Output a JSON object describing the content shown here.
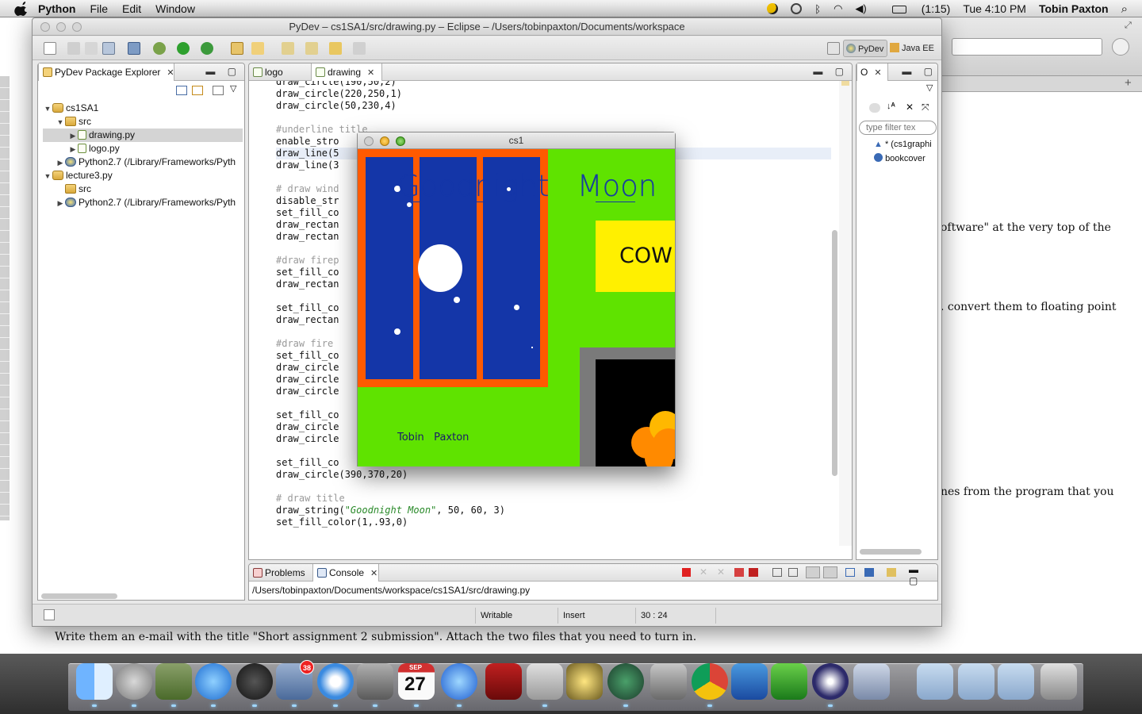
{
  "menubar": {
    "app_name": "Python",
    "menus": [
      "File",
      "Edit",
      "Window"
    ],
    "battery": "(1:15)",
    "clock": "Tue 4:10 PM",
    "user": "Tobin Paxton"
  },
  "browser_bg": {
    "lines": [
      "oftware\" at the very top of the",
      ". convert them to floating point",
      "nes from the program that you",
      "Write them an e-mail with the title \"Short assignment 2 submission\". Attach the two files that you need to turn in."
    ]
  },
  "eclipse": {
    "title": "PyDev – cs1SA1/src/drawing.py – Eclipse – /Users/tobinpaxton/Documents/workspace",
    "perspectives": [
      "PyDev",
      "Java EE"
    ],
    "package_explorer": {
      "tab_label": "PyDev Package Explorer",
      "tree": [
        {
          "label": "cs1SA1",
          "icon": "project-icon",
          "twisty": "▼",
          "depth": 0
        },
        {
          "label": "src",
          "icon": "folder-icon",
          "twisty": "▼",
          "depth": 1
        },
        {
          "label": "drawing.py",
          "icon": "python-file-icon",
          "twisty": "▶",
          "depth": 2,
          "selected": true
        },
        {
          "label": "logo.py",
          "icon": "python-file-icon",
          "twisty": "▶",
          "depth": 2
        },
        {
          "label": "Python2.7  (/Library/Frameworks/Pyth",
          "icon": "python-lib-icon",
          "twisty": "▶",
          "depth": 1
        },
        {
          "label": "lecture3.py",
          "icon": "project-icon",
          "twisty": "▼",
          "depth": 0
        },
        {
          "label": "src",
          "icon": "folder-icon",
          "twisty": "",
          "depth": 1
        },
        {
          "label": "Python2.7  (/Library/Frameworks/Pyth",
          "icon": "python-lib-icon",
          "twisty": "▶",
          "depth": 1
        }
      ]
    },
    "editor": {
      "tabs": [
        "logo",
        "drawing"
      ],
      "lines": [
        {
          "text": "draw_circle(190,50,2)",
          "kind": "code"
        },
        {
          "text": "draw_circle(220,250,1)",
          "kind": "code"
        },
        {
          "text": "draw_circle(50,230,4)",
          "kind": "code"
        },
        {
          "text": "",
          "kind": "code"
        },
        {
          "text": "#underline title",
          "kind": "comment"
        },
        {
          "text": "enable_stro",
          "kind": "code"
        },
        {
          "text": "draw_line(5",
          "kind": "code",
          "highlight": true
        },
        {
          "text": "draw_line(3",
          "kind": "code"
        },
        {
          "text": "",
          "kind": "code"
        },
        {
          "text": "# draw wind",
          "kind": "comment"
        },
        {
          "text": "disable_str",
          "kind": "code"
        },
        {
          "text": "set_fill_co",
          "kind": "code"
        },
        {
          "text": "draw_rectan",
          "kind": "code"
        },
        {
          "text": "draw_rectan",
          "kind": "code"
        },
        {
          "text": "",
          "kind": "code"
        },
        {
          "text": "#draw firep",
          "kind": "comment"
        },
        {
          "text": "set_fill_co",
          "kind": "code"
        },
        {
          "text": "draw_rectan",
          "kind": "code"
        },
        {
          "text": "",
          "kind": "code"
        },
        {
          "text": "set_fill_co",
          "kind": "code"
        },
        {
          "text": "draw_rectan",
          "kind": "code"
        },
        {
          "text": "",
          "kind": "code"
        },
        {
          "text": "#draw fire",
          "kind": "comment"
        },
        {
          "text": "set_fill_co",
          "kind": "code"
        },
        {
          "text": "draw_circle",
          "kind": "code"
        },
        {
          "text": "draw_circle",
          "kind": "code"
        },
        {
          "text": "draw_circle",
          "kind": "code"
        },
        {
          "text": "",
          "kind": "code"
        },
        {
          "text": "set_fill_co",
          "kind": "code"
        },
        {
          "text": "draw_circle",
          "kind": "code"
        },
        {
          "text": "draw_circle",
          "kind": "code"
        },
        {
          "text": "",
          "kind": "code"
        },
        {
          "text": "set_fill_co",
          "kind": "code"
        },
        {
          "text": "draw_circle(390,370,20)",
          "kind": "code"
        },
        {
          "text": "",
          "kind": "code"
        },
        {
          "text": "# draw title",
          "kind": "comment"
        },
        {
          "text_pre": "draw_string(",
          "text_str": "\"Goodnight Moon\"",
          "text_post": ", 50, 60, 3)",
          "kind": "string"
        },
        {
          "text": "set_fill_color(1,.93,0)",
          "kind": "code"
        }
      ]
    },
    "outline": {
      "tab_label": "O",
      "filter_placeholder": "type filter tex",
      "items": [
        "* (cs1graphi",
        "bookcover"
      ]
    },
    "bottom": {
      "tabs": [
        "Problems",
        "Console"
      ],
      "console_path": "/Users/tobinpaxton/Documents/workspace/cs1SA1/src/drawing.py"
    },
    "status": {
      "writable": "Writable",
      "insert": "Insert",
      "position": "30 : 24"
    }
  },
  "cs1": {
    "title": "cs1",
    "heading": "Goodnight   Moon",
    "cow_label": "COW",
    "signature": "Tobin   Paxton",
    "colors": {
      "wall": "#5fe300",
      "window_frame": "#ff5a00",
      "sky": "#1436a8",
      "cow_box": "#fff000",
      "fireplace": "#7a7a7a",
      "fire": "#ff8a00"
    }
  },
  "dock": {
    "icons": [
      "finder-icon",
      "launchpad-icon",
      "system-preferences-icon",
      "app-store-icon",
      "dashboard-icon",
      "mail-icon",
      "safari-icon",
      "facetime-icon",
      "calendar-icon",
      "itunes-icon",
      "photo-booth-icon",
      "preview-icon",
      "imovie-icon",
      "time-machine-icon",
      "settings-icon",
      "chrome-icon",
      "word-icon",
      "excel-icon",
      "eclipse-icon",
      "pen-icon",
      "folder-icon",
      "applications-icon",
      "documents-icon",
      "trash-icon"
    ],
    "mail_badge": "38",
    "calendar_month": "SEP",
    "calendar_day": "27"
  }
}
